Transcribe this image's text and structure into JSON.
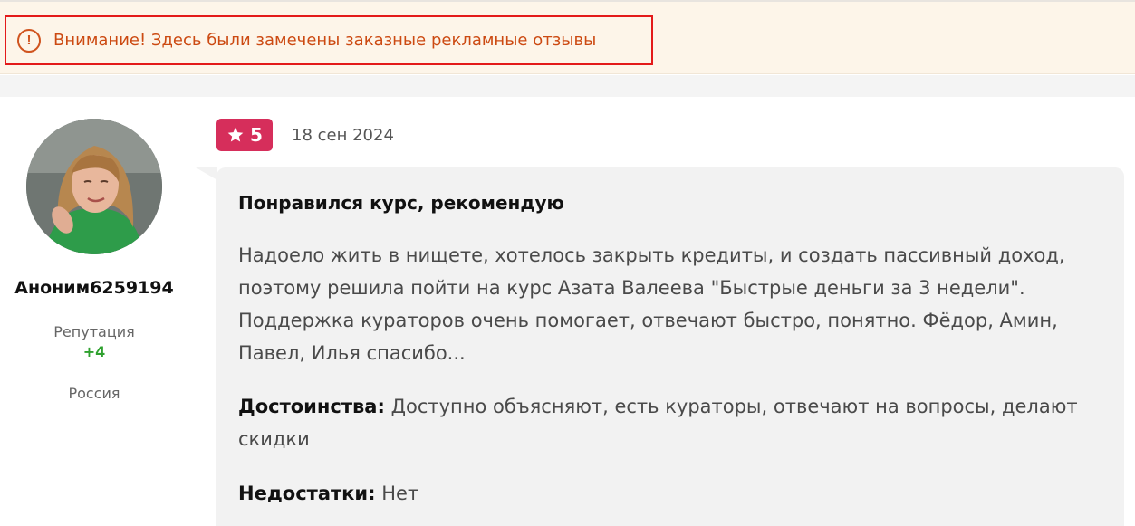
{
  "warning": {
    "icon": "exclamation-circle-icon",
    "text": "Внимание! Здесь были замечены заказные рекламные отзывы",
    "color": "#cc4a12",
    "border_color": "#e31a1a"
  },
  "author": {
    "name": "Аноним6259194",
    "reputation_label": "Репутация",
    "reputation_value": "+4",
    "country": "Россия"
  },
  "review": {
    "rating": "5",
    "rating_color": "#d62e5b",
    "date": "18 сен 2024",
    "title": "Понравился курс, рекомендую",
    "body": "Надоело жить в нищете, хотелось закрыть кредиты, и создать пассивный доход, поэтому решила пойти на курс Азата Валеева \"Быстрые деньги за 3 недели\". Поддержка кураторов очень помогает, отвечают быстро, понятно. Фёдор, Амин, Павел, Илья спасибо...",
    "pros_label": "Достоинства:",
    "pros_text": "Доступно объясняют, есть кураторы, отвечают на вопросы, делают скидки",
    "cons_label": "Недостатки:",
    "cons_text": "Нет"
  }
}
